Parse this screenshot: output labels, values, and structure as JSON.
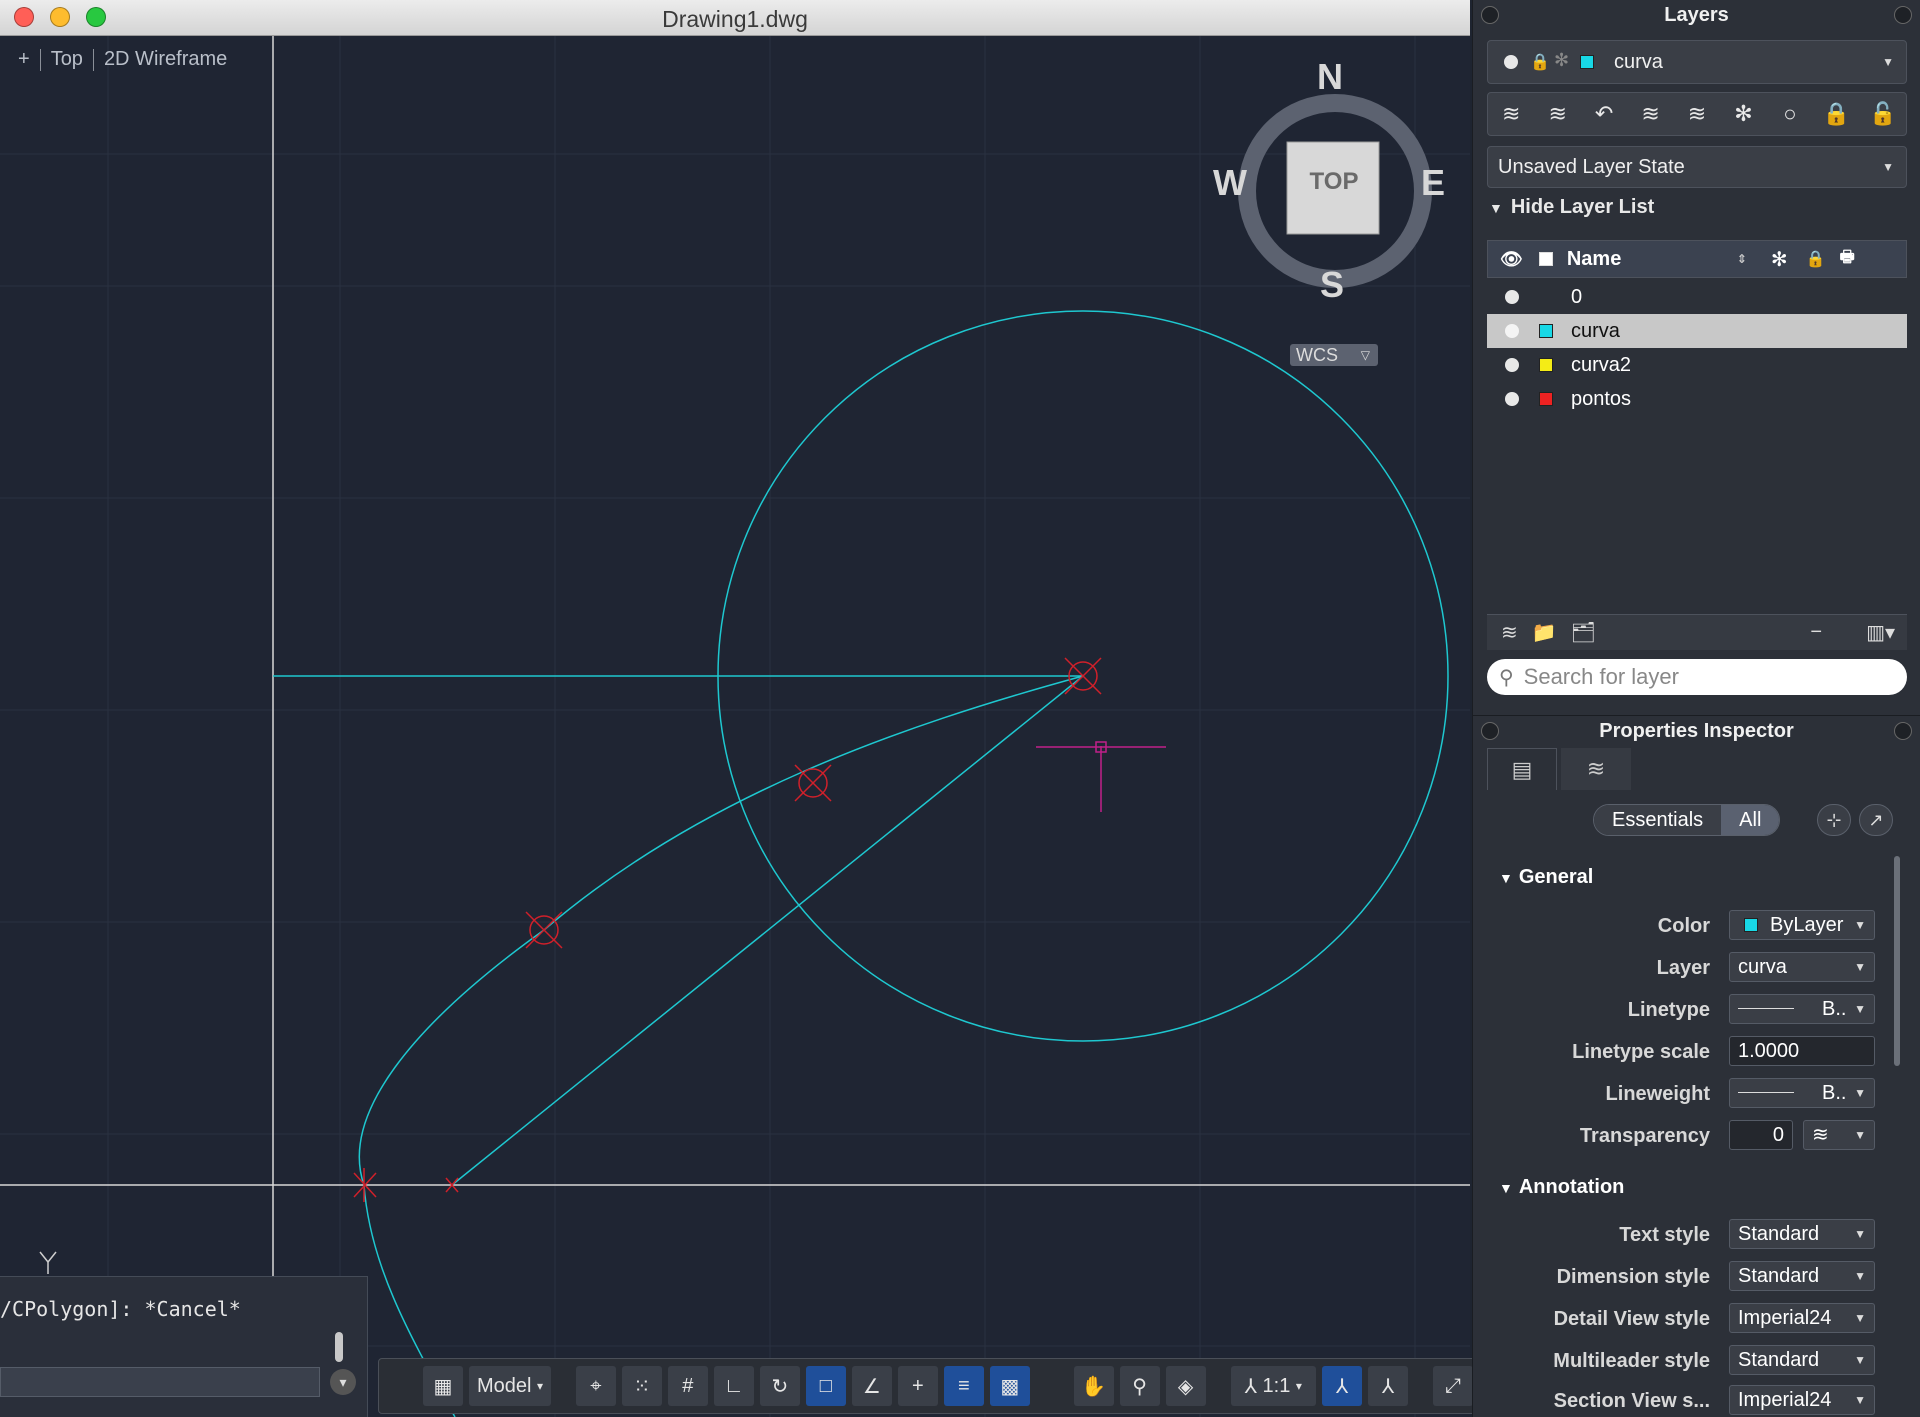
{
  "window": {
    "title": "Drawing1.dwg"
  },
  "viewport": {
    "plus": "+",
    "view": "Top",
    "visual_style": "2D Wireframe",
    "viewcube": {
      "n": "N",
      "s": "S",
      "e": "E",
      "w": "W",
      "face": "TOP",
      "ucs": "WCS"
    },
    "ucs_axis_label": "Y"
  },
  "command_line": {
    "history_text": "/CPolygon]: *Cancel*"
  },
  "status_bar": {
    "model_label": "Model",
    "scale_label": "1:1"
  },
  "layers_panel": {
    "title": "Layers",
    "current_layer": {
      "name": "curva",
      "color": "#18d8e6"
    },
    "layer_state": "Unsaved Layer State",
    "hide_list_label": "Hide Layer List",
    "header_name": "Name",
    "rows": [
      {
        "name": "0",
        "color": ""
      },
      {
        "name": "curva",
        "color": "#18d8e6"
      },
      {
        "name": "curva2",
        "color": "#f4ec16"
      },
      {
        "name": "pontos",
        "color": "#ee2222"
      }
    ],
    "selected_index": 1,
    "search_placeholder": "Search for layer"
  },
  "properties": {
    "title": "Properties Inspector",
    "seg_essentials": "Essentials",
    "seg_all": "All",
    "general": {
      "title": "General",
      "color_label": "Color",
      "color_value": "ByLayer",
      "layer_label": "Layer",
      "layer_value": "curva",
      "linetype_label": "Linetype",
      "linetype_value": "B..",
      "linetype_scale_label": "Linetype scale",
      "linetype_scale_value": "1.0000",
      "lineweight_label": "Lineweight",
      "lineweight_value": "B..",
      "transparency_label": "Transparency",
      "transparency_value": "0"
    },
    "annotation": {
      "title": "Annotation",
      "text_style_label": "Text style",
      "text_style_value": "Standard",
      "dimension_style_label": "Dimension style",
      "dimension_style_value": "Standard",
      "detail_view_style_label": "Detail View style",
      "detail_view_style_value": "Imperial24",
      "multileader_style_label": "Multileader style",
      "multileader_style_value": "Standard",
      "section_view_style_label": "Section View s...",
      "section_view_style_value": "Imperial24"
    }
  },
  "colors": {
    "entity": "#1ec8d0",
    "marker": "#d0202a",
    "cursor": "#c0208a",
    "background": "#1f2533"
  }
}
